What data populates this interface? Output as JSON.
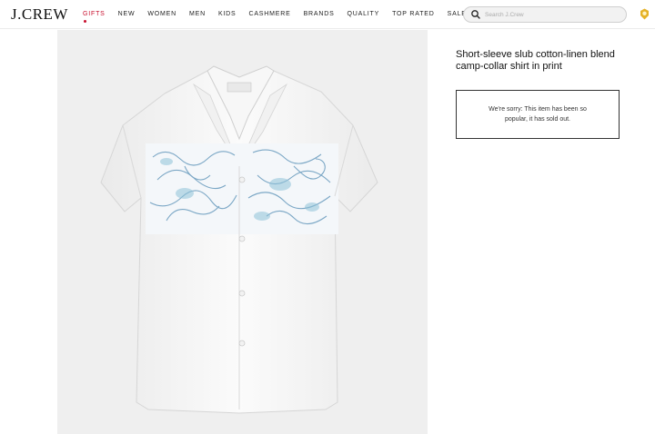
{
  "brand": {
    "logo": "J.CREW"
  },
  "nav": {
    "items": [
      "GIFTS",
      "NEW",
      "WOMEN",
      "MEN",
      "KIDS",
      "CASHMERE",
      "BRANDS",
      "QUALITY",
      "TOP RATED",
      "SALE"
    ],
    "active": "GIFTS",
    "accent_color": "#c8102e"
  },
  "search": {
    "placeholder": "Search J.Crew",
    "icon": "search-icon"
  },
  "header_icon": "rewards-badge-icon",
  "product": {
    "title": "Short-sleeve slub cotton-linen blend camp-collar shirt in print",
    "soldout_message": "We're sorry: This item has been so popular, it has sold out.",
    "image_alt": "shirt-image"
  }
}
